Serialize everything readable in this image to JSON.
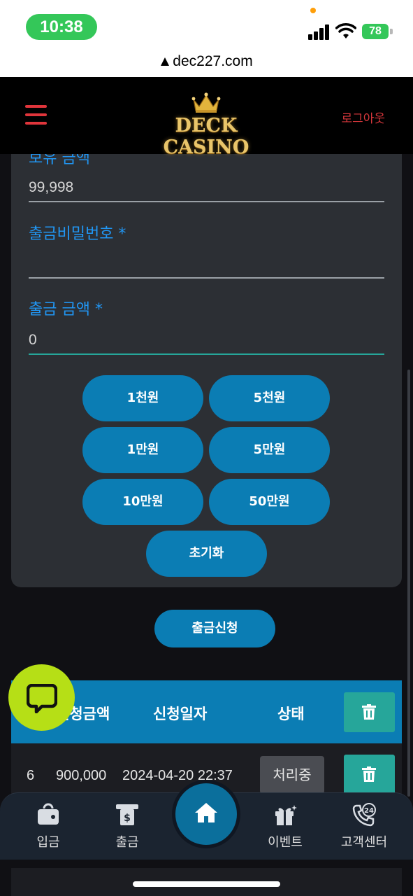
{
  "status_bar": {
    "time": "10:38",
    "battery": "78",
    "url": "dec227.com"
  },
  "header": {
    "brand": "DECK CASINO",
    "logout_label": "로그아웃"
  },
  "form": {
    "balance_label": "보유 금액",
    "balance_value": "99,998",
    "password_label": "출금비밀번호 *",
    "password_value": "",
    "amount_label": "출금 금액 *",
    "amount_value": "0",
    "amount_buttons": [
      "1천원",
      "5천원",
      "1만원",
      "5만원",
      "10만원",
      "50만원"
    ],
    "reset_label": "초기화",
    "apply_label": "출금신청"
  },
  "table": {
    "headers": [
      "신청금액",
      "신청일자",
      "상태"
    ],
    "rows": [
      {
        "no": "6",
        "amount": "900,000",
        "date": "2024-04-20 22:37",
        "status": "처리중"
      }
    ]
  },
  "bottom_nav": {
    "items": [
      "입금",
      "출금",
      "이벤트",
      "고객센터"
    ]
  },
  "colors": {
    "accent": "#0b7db4",
    "danger": "#e0353b",
    "teal": "#26a69a",
    "chat": "#b6df16"
  }
}
